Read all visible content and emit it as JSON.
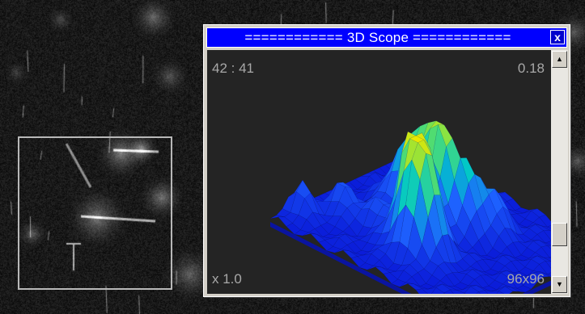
{
  "window": {
    "title": "============  3D Scope  ============",
    "close_label": "x"
  },
  "scope": {
    "coords": "42 : 41",
    "level": "0.18",
    "zoom": "x 1.0",
    "grid_size": "96x96"
  },
  "scrollbar": {
    "up_icon": "▲",
    "down_icon": "▼",
    "thumb_position": 0.84
  },
  "colors": {
    "titlebar": "#0000ff",
    "surface_low": "#0a1ad8",
    "surface_mid": "#00c8c8",
    "surface_high": "#e8e800",
    "viewport_bg": "#242424"
  },
  "icons": {
    "close": "close-icon",
    "scroll_up": "arrow-up-icon",
    "scroll_down": "arrow-down-icon"
  }
}
